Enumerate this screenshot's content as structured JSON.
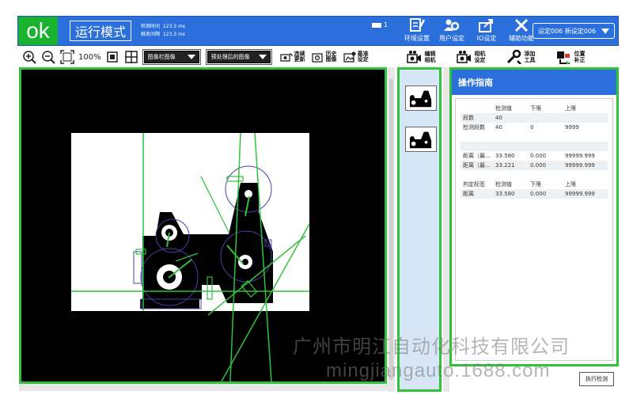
{
  "header": {
    "status": "ok",
    "mode": "运行模式",
    "detect_time_label": "检测时间",
    "detect_time_value": "123.3 ms",
    "trigger_label": "触发间隔",
    "trigger_value": "123.3 ms",
    "camera_indicator": "1",
    "buttons": [
      {
        "label": "环境设置",
        "icon": "environment-settings-icon"
      },
      {
        "label": "用户设定",
        "icon": "user-settings-icon"
      },
      {
        "label": "IO设定",
        "icon": "io-settings-icon"
      },
      {
        "label": "辅助功能",
        "icon": "tools-icon"
      }
    ],
    "preset": "设定006 新设定006"
  },
  "toolbar": {
    "zoom": "100%",
    "image_select": "图像栏图像",
    "process_select": "预处理后的图像",
    "continuous_update": [
      "连续",
      "更新"
    ],
    "history_image": [
      "历史",
      "图像"
    ],
    "reference_setting": [
      "基准",
      "设定"
    ]
  },
  "toolbar2": {
    "edit_camera": [
      "编辑",
      "相机"
    ],
    "camera_settings": [
      "相机",
      "设定"
    ],
    "add_tool": [
      "添加",
      "工具"
    ],
    "position_correction": [
      "位置",
      "补正"
    ]
  },
  "guide": {
    "title": "操作指南",
    "table1_header": [
      "",
      "检测值",
      "下限",
      "上限"
    ],
    "table1_rows": [
      [
        "段数",
        "40",
        "",
        ""
      ],
      [
        "检测段数",
        "40",
        "0",
        "9999"
      ]
    ],
    "table2_rows": [
      [
        "距离（最…",
        "33.580",
        "0.000",
        "99999.999"
      ],
      [
        "距离（最…",
        "33.221",
        "0.000",
        "99999.999"
      ]
    ],
    "table3_header": [
      "判定标签",
      "检测值",
      "下限",
      "上限"
    ],
    "table3_rows": [
      [
        "距离",
        "33.580",
        "0.000",
        "99999.999"
      ]
    ]
  },
  "run_button": "执行检测",
  "watermark": {
    "line1": "广州市明江自动化科技有限公司",
    "line2": "mingjiangauto.1688.com"
  },
  "colors": {
    "header_blue": "#2a6fdb",
    "ok_green": "#19b22e",
    "frame_green": "#2fc23a",
    "thumb_panel": "#d7e6f6"
  }
}
